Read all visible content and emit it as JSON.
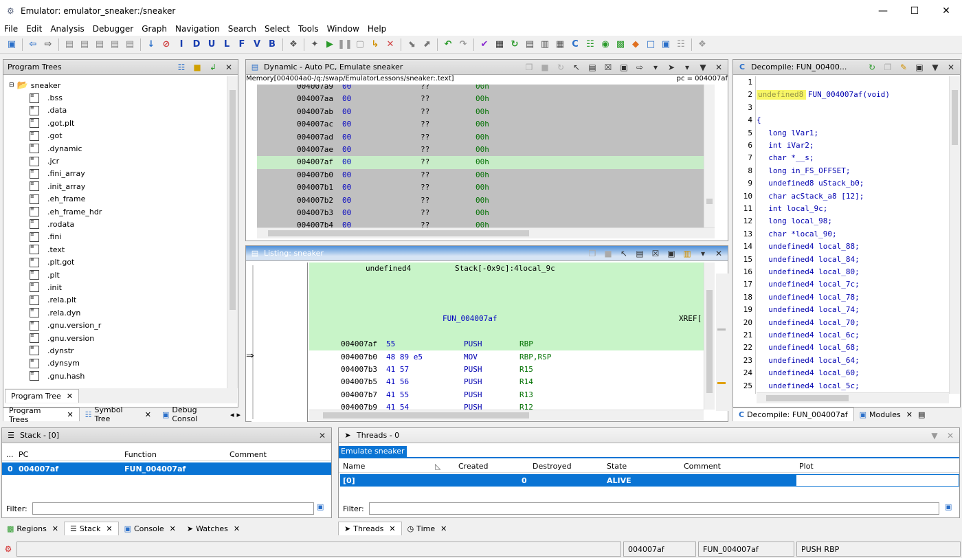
{
  "window": {
    "title": "Emulator: emulator_sneaker:/sneaker",
    "minimize": "—",
    "maximize": "☐",
    "close": "✕"
  },
  "menu": [
    "File",
    "Edit",
    "Analysis",
    "Debugger",
    "Graph",
    "Navigation",
    "Search",
    "Select",
    "Tools",
    "Window",
    "Help"
  ],
  "program_trees": {
    "title": "Program Trees",
    "root": "sneaker",
    "sections": [
      ".bss",
      ".data",
      ".got.plt",
      ".got",
      ".dynamic",
      ".jcr",
      ".fini_array",
      ".init_array",
      ".eh_frame",
      ".eh_frame_hdr",
      ".rodata",
      ".fini",
      ".text",
      ".plt.got",
      ".plt",
      ".init",
      ".rela.plt",
      ".rela.dyn",
      ".gnu.version_r",
      ".gnu.version",
      ".dynstr",
      ".dynsym",
      ".gnu.hash"
    ],
    "inner_tab": "Program Tree",
    "tabs": [
      "Program Trees",
      "Symbol Tree",
      "Debug Consol"
    ]
  },
  "dynamic": {
    "title": "Dynamic - Auto PC, Emulate sneaker",
    "memory_label": "Memory[004004a0-/q:/swap/EmulatorLessons/sneaker:.text]",
    "pc_label": "pc = 004007af",
    "rows": [
      {
        "addr": "004007a9",
        "byte": "00",
        "q": "??",
        "val": "00h"
      },
      {
        "addr": "004007aa",
        "byte": "00",
        "q": "??",
        "val": "00h"
      },
      {
        "addr": "004007ab",
        "byte": "00",
        "q": "??",
        "val": "00h"
      },
      {
        "addr": "004007ac",
        "byte": "00",
        "q": "??",
        "val": "00h"
      },
      {
        "addr": "004007ad",
        "byte": "00",
        "q": "??",
        "val": "00h"
      },
      {
        "addr": "004007ae",
        "byte": "00",
        "q": "??",
        "val": "00h"
      },
      {
        "addr": "004007af",
        "byte": "00",
        "q": "??",
        "val": "00h"
      },
      {
        "addr": "004007b0",
        "byte": "00",
        "q": "??",
        "val": "00h"
      },
      {
        "addr": "004007b1",
        "byte": "00",
        "q": "??",
        "val": "00h"
      },
      {
        "addr": "004007b2",
        "byte": "00",
        "q": "??",
        "val": "00h"
      },
      {
        "addr": "004007b3",
        "byte": "00",
        "q": "??",
        "val": "00h"
      },
      {
        "addr": "004007b4",
        "byte": "00",
        "q": "??",
        "val": "00h"
      }
    ],
    "highlight_index": 6
  },
  "listing": {
    "title": "Listing:  sneaker",
    "header_type": "undefined4",
    "header_stack": "Stack[-0x9c]:4local_9c",
    "func_label": "FUN_004007af",
    "xref": "XREF[",
    "rows": [
      {
        "addr": "004007af",
        "bytes": "55",
        "mnem": "PUSH",
        "ops": "RBP"
      },
      {
        "addr": "004007b0",
        "bytes": "48 89 e5",
        "mnem": "MOV",
        "ops": "RBP,RSP"
      },
      {
        "addr": "004007b3",
        "bytes": "41 57",
        "mnem": "PUSH",
        "ops": "R15"
      },
      {
        "addr": "004007b5",
        "bytes": "41 56",
        "mnem": "PUSH",
        "ops": "R14"
      },
      {
        "addr": "004007b7",
        "bytes": "41 55",
        "mnem": "PUSH",
        "ops": "R13"
      },
      {
        "addr": "004007b9",
        "bytes": "41 54",
        "mnem": "PUSH",
        "ops": "R12"
      }
    ]
  },
  "decompile": {
    "title": "Decompile: FUN_00400...",
    "tabs": [
      "Decompile: FUN_004007af",
      "Modules"
    ],
    "lines": [
      {
        "n": "1",
        "code": ""
      },
      {
        "n": "2",
        "code": "undefined8 FUN_004007af(void)"
      },
      {
        "n": "3",
        "code": ""
      },
      {
        "n": "4",
        "code": "{"
      },
      {
        "n": "5",
        "code": "  long lVar1;"
      },
      {
        "n": "6",
        "code": "  int iVar2;"
      },
      {
        "n": "7",
        "code": "  char *__s;"
      },
      {
        "n": "8",
        "code": "  long in_FS_OFFSET;"
      },
      {
        "n": "9",
        "code": "  undefined8 uStack_b0;"
      },
      {
        "n": "10",
        "code": "  char acStack_a8 [12];"
      },
      {
        "n": "11",
        "code": "  int local_9c;"
      },
      {
        "n": "12",
        "code": "  long local_98;"
      },
      {
        "n": "13",
        "code": "  char *local_90;"
      },
      {
        "n": "14",
        "code": "  undefined4 local_88;"
      },
      {
        "n": "15",
        "code": "  undefined4 local_84;"
      },
      {
        "n": "16",
        "code": "  undefined4 local_80;"
      },
      {
        "n": "17",
        "code": "  undefined4 local_7c;"
      },
      {
        "n": "18",
        "code": "  undefined4 local_78;"
      },
      {
        "n": "19",
        "code": "  undefined4 local_74;"
      },
      {
        "n": "20",
        "code": "  undefined4 local_70;"
      },
      {
        "n": "21",
        "code": "  undefined4 local_6c;"
      },
      {
        "n": "22",
        "code": "  undefined4 local_68;"
      },
      {
        "n": "23",
        "code": "  undefined4 local_64;"
      },
      {
        "n": "24",
        "code": "  undefined4 local_60;"
      },
      {
        "n": "25",
        "code": "  undefined4 local_5c;"
      }
    ]
  },
  "stack": {
    "title": "Stack - [0]",
    "cols": {
      "dots": "...",
      "pc": "PC",
      "function": "Function",
      "comment": "Comment"
    },
    "row": {
      "idx": "0",
      "pc": "004007af",
      "function": "FUN_004007af"
    },
    "filter_label": "Filter:",
    "tabs": [
      "Regions",
      "Stack",
      "Console",
      "Watches"
    ]
  },
  "threads": {
    "title": "Threads - 0",
    "subtab": "Emulate sneaker",
    "cols": {
      "name": "Name",
      "created": "Created",
      "destroyed": "Destroyed",
      "state": "State",
      "comment": "Comment",
      "plot": "Plot"
    },
    "row": {
      "name": "[0]",
      "destroyed": "0",
      "state": "ALIVE"
    },
    "filter_label": "Filter:",
    "tabs": [
      "Threads",
      "Time"
    ]
  },
  "statusbar": {
    "addr": "004007af",
    "func": "FUN_004007af",
    "instr": "PUSH RBP"
  }
}
